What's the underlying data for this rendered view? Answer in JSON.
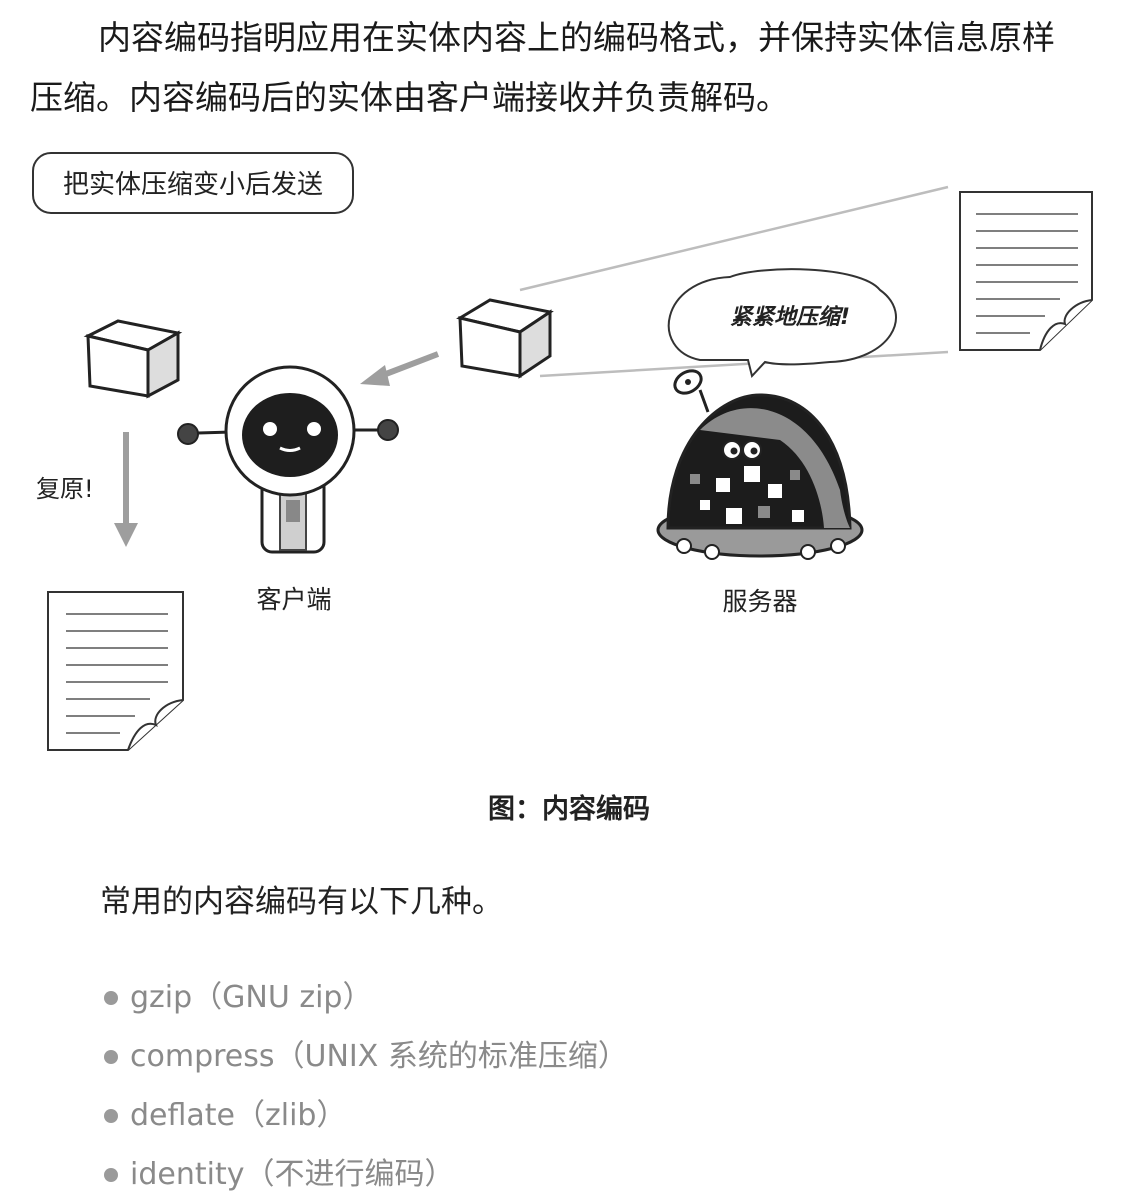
{
  "intro": {
    "line1": "内容编码指明应用在实体内容上的编码格式，并保持实体信息原样",
    "line2": "压缩。内容编码后的实体由客户端接收并负责解码。"
  },
  "figure": {
    "label_box": "把实体压缩变小后发送",
    "speech": "紧紧地压缩!",
    "restore": "复原!",
    "client": "客户端",
    "server": "服务器"
  },
  "caption": "图：内容编码",
  "lead": "常用的内容编码有以下几种。",
  "encodings": [
    "gzip（GNU zip）",
    "compress（UNIX 系统的标准压缩）",
    "deflate（zlib）",
    "identity（不进行编码）"
  ]
}
